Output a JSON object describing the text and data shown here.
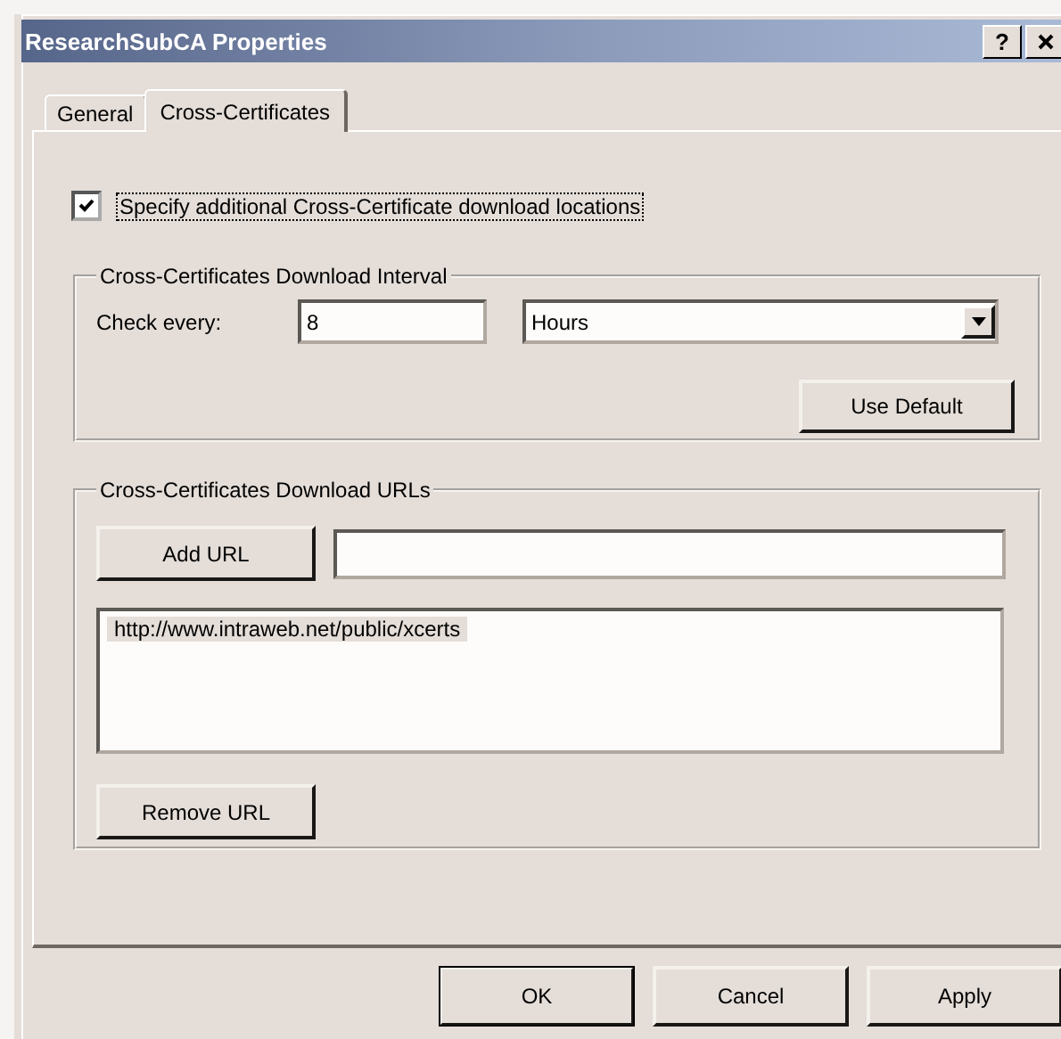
{
  "window": {
    "title": "ResearchSubCA Properties",
    "help_button": "?"
  },
  "tabs": [
    {
      "label": "General",
      "selected": false
    },
    {
      "label": "Cross-Certificates",
      "selected": true
    }
  ],
  "specify_checkbox": {
    "label": "Specify additional Cross-Certificate download locations",
    "checked": true,
    "focused": true
  },
  "interval_group": {
    "title": "Cross-Certificates Download Interval",
    "check_every_label": "Check every:",
    "check_every_value": "8",
    "unit": "Hours",
    "use_default_button": "Use Default"
  },
  "urls_group": {
    "title": "Cross-Certificates Download URLs",
    "add_button": "Add URL",
    "urls": [
      {
        "text": "http://www.intraweb.net/public/xcerts",
        "selected": true
      }
    ],
    "remove_button": "Remove URL"
  },
  "buttons": [
    {
      "label": "OK",
      "default": true
    },
    {
      "label": "Cancel",
      "default": false
    },
    {
      "label": "Apply",
      "default": false
    }
  ]
}
